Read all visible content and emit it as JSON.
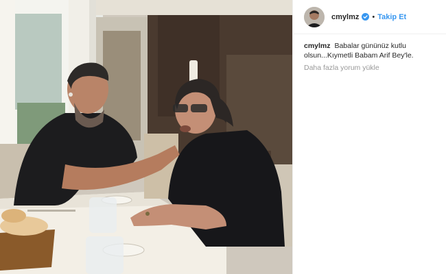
{
  "post": {
    "username": "cmylmz",
    "follow_label": "Takip Et",
    "separator": "•",
    "icons": {
      "verified": "verified-badge-icon",
      "avatar": "profile-avatar"
    },
    "accent_color": "#3897f0"
  },
  "caption": {
    "username": "cmylmz",
    "text": "Babalar gününüz kutlu olsun...Kıymetli Babam Arif Bey'le."
  },
  "comments": {
    "load_more_label": "Daha fazla yorum yükle"
  },
  "photo": {
    "description_icon": "post-photo"
  }
}
